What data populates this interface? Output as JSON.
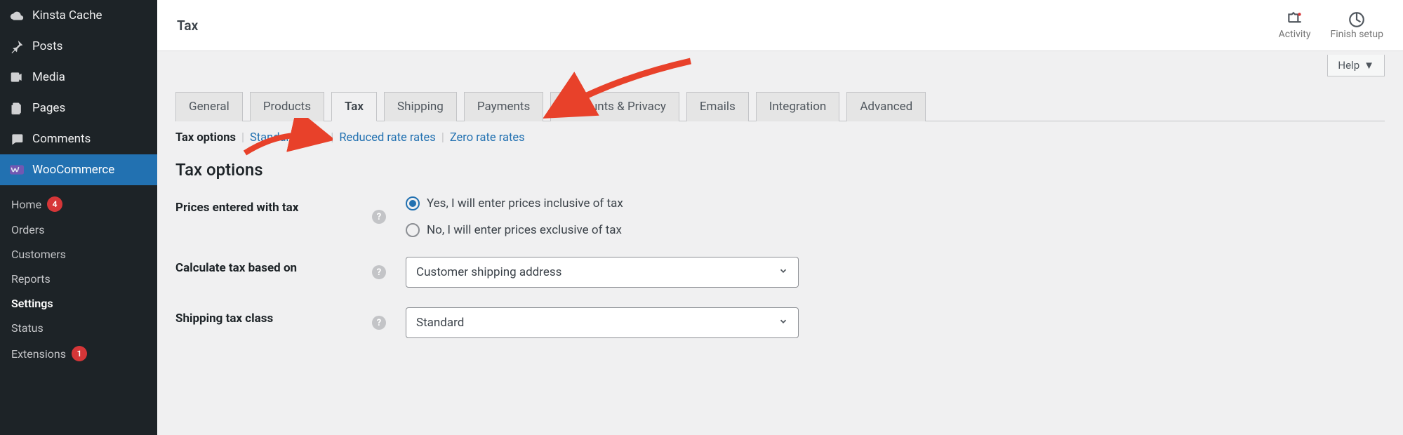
{
  "sidebar": {
    "items": [
      {
        "label": "Kinsta Cache",
        "icon": "cloud"
      },
      {
        "label": "Posts",
        "icon": "pin"
      },
      {
        "label": "Media",
        "icon": "media"
      },
      {
        "label": "Pages",
        "icon": "pages"
      },
      {
        "label": "Comments",
        "icon": "comment"
      },
      {
        "label": "WooCommerce",
        "icon": "woo",
        "active": true
      }
    ],
    "submenu": [
      {
        "label": "Home",
        "badge": "4"
      },
      {
        "label": "Orders"
      },
      {
        "label": "Customers"
      },
      {
        "label": "Reports"
      },
      {
        "label": "Settings",
        "current": true
      },
      {
        "label": "Status"
      },
      {
        "label": "Extensions",
        "badge": "1"
      }
    ]
  },
  "topbar": {
    "title": "Tax",
    "activity": "Activity",
    "finish": "Finish setup",
    "help": "Help"
  },
  "tabs": [
    "General",
    "Products",
    "Tax",
    "Shipping",
    "Payments",
    "Accounts & Privacy",
    "Emails",
    "Integration",
    "Advanced"
  ],
  "active_tab": "Tax",
  "subsub": {
    "current": "Tax options",
    "links": [
      "Standard rates",
      "Reduced rate rates",
      "Zero rate rates"
    ]
  },
  "section_title": "Tax options",
  "form": {
    "prices_label": "Prices entered with tax",
    "prices_options": [
      "Yes, I will enter prices inclusive of tax",
      "No, I will enter prices exclusive of tax"
    ],
    "prices_selected": 0,
    "calc_label": "Calculate tax based on",
    "calc_value": "Customer shipping address",
    "shipclass_label": "Shipping tax class",
    "shipclass_value": "Standard"
  }
}
